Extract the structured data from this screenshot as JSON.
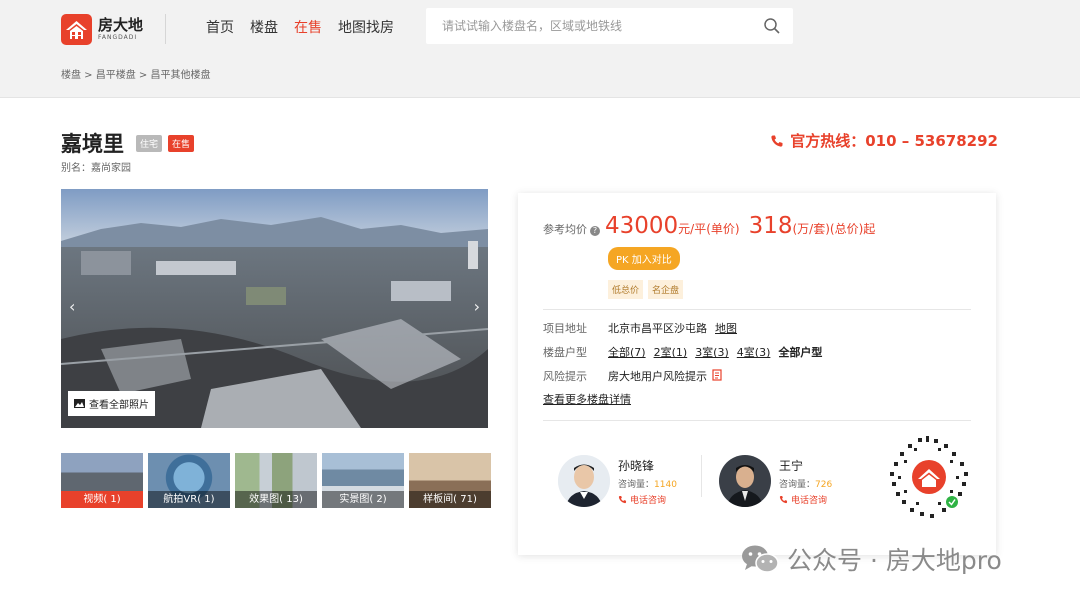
{
  "header": {
    "logo_cn": "房大地",
    "logo_en": "FANGDADI",
    "nav": [
      "首页",
      "楼盘",
      "在售",
      "地图找房"
    ],
    "nav_active_index": 2,
    "search_placeholder": "请试试输入楼盘名，区域或地铁线",
    "breadcrumb": "楼盘 > 昌平楼盘 > 昌平其他楼盘"
  },
  "property": {
    "name": "嘉境里",
    "type_badge": "住宅",
    "status_badge": "在售",
    "alias": "别名：嘉尚家园",
    "hotline": "官方热线：010 – 53678292"
  },
  "gallery": {
    "view_all": "查看全部照片",
    "thumbs": [
      "视频( 1)",
      "航拍VR( 1)",
      "效果图( 13)",
      "实景图( 2)",
      "样板间( 71)"
    ],
    "selected_thumb": 0
  },
  "card": {
    "price_label": "参考均价",
    "unit_price": "43000",
    "unit_price_suffix": "元/平(单价)",
    "total_price": "318",
    "total_price_suffix": "(万/套)(总价)起",
    "pk_label": "PK 加入对比",
    "tags": [
      "低总价",
      "名企盘"
    ],
    "address_label": "项目地址",
    "address": "北京市昌平区沙屯路",
    "map_link": "地图",
    "layout_label": "楼盘户型",
    "layouts": [
      "全部(7)",
      "2室(1)",
      "3室(3)",
      "4室(3)"
    ],
    "layouts_all": "全部户型",
    "risk_label": "风险提示",
    "risk_text": "房大地用户风险提示",
    "more_link": "查看更多楼盘详情"
  },
  "agents": [
    {
      "name": "孙晓锋",
      "stat_label": "咨询量：",
      "stat_value": "1140",
      "call": "电话咨询"
    },
    {
      "name": "王宁",
      "stat_label": "咨询量：",
      "stat_value": "726",
      "call": "电话咨询"
    }
  ],
  "watermark": "公众号 · 房大地pro",
  "colors": {
    "accent": "#e8412b",
    "orange": "#f5a623"
  }
}
